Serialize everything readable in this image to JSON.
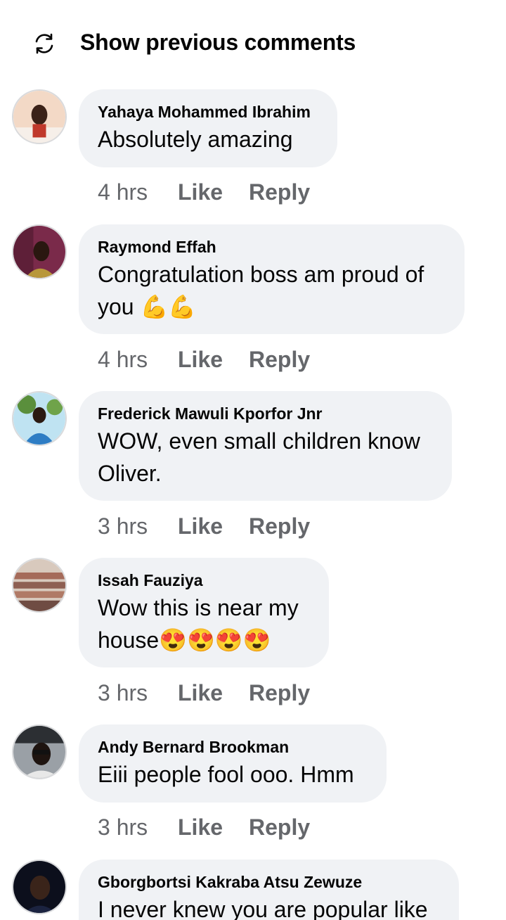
{
  "header": {
    "show_previous_label": "Show previous comments",
    "icon": "refresh-icon"
  },
  "comments": [
    {
      "author": "Yahaya Mohammed Ibrahim",
      "text": "Absolutely amazing",
      "time": "4 hrs",
      "like_label": "Like",
      "reply_label": "Reply"
    },
    {
      "author": "Raymond Effah",
      "text": "Congratulation boss am proud of you 💪💪",
      "time": "4 hrs",
      "like_label": "Like",
      "reply_label": "Reply"
    },
    {
      "author": "Frederick Mawuli Kporfor Jnr",
      "text": "WOW, even small children know Oliver.",
      "time": "3 hrs",
      "like_label": "Like",
      "reply_label": "Reply"
    },
    {
      "author": "Issah Fauziya",
      "text": "Wow this is near my house😍😍😍😍",
      "time": "3 hrs",
      "like_label": "Like",
      "reply_label": "Reply"
    },
    {
      "author": "Andy Bernard Brookman",
      "text": "Eiii people fool ooo. Hmm",
      "time": "3 hrs",
      "like_label": "Like",
      "reply_label": "Reply"
    },
    {
      "author": "Gborgbortsi Kakraba Atsu Zewuze",
      "text": "I never knew you are popular like"
    }
  ],
  "colors": {
    "bubble": "#f0f2f5",
    "text": "#050505",
    "secondary": "#65676b"
  }
}
